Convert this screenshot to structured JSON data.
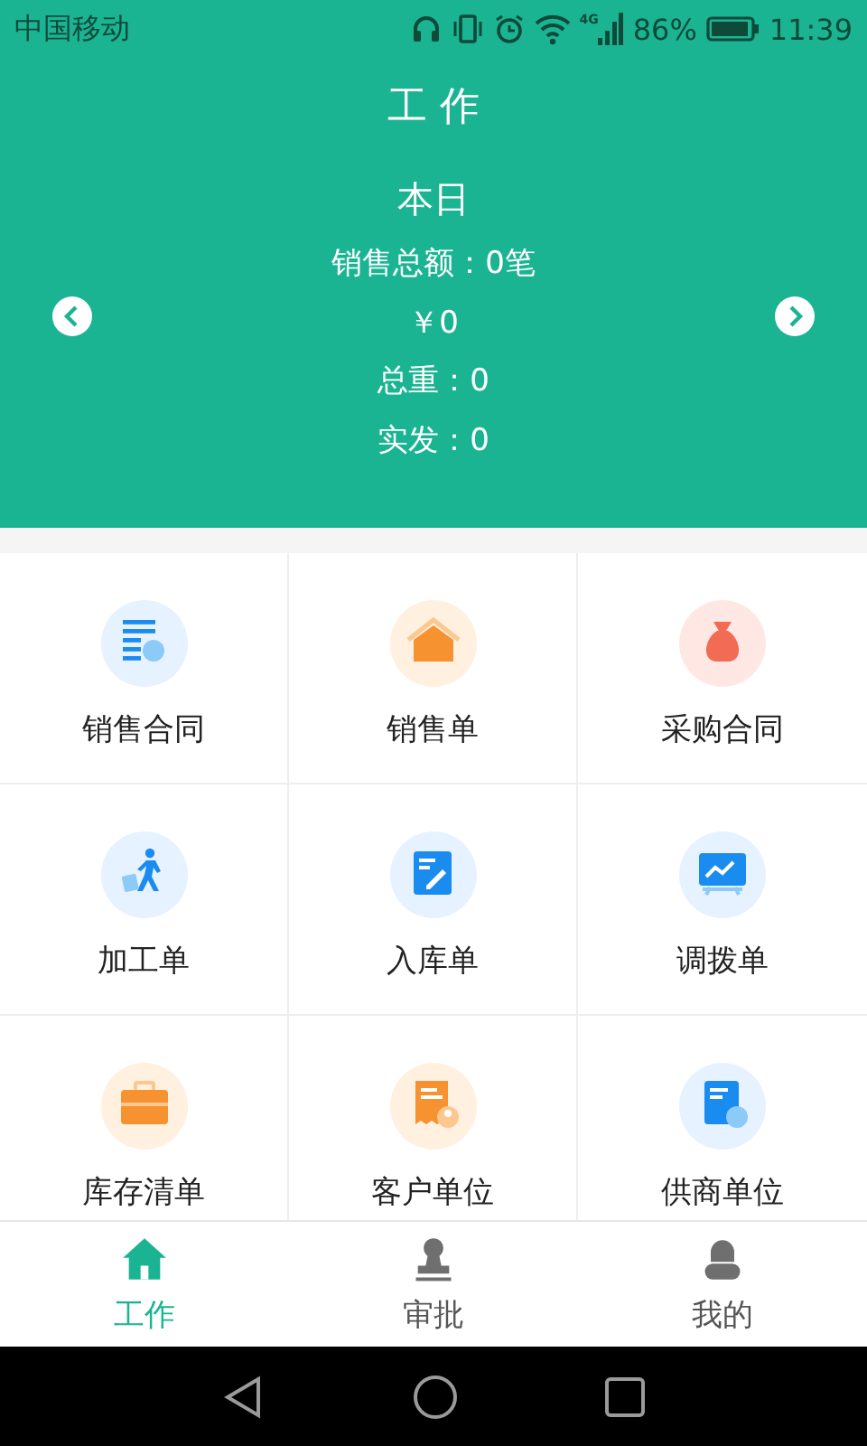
{
  "status_bar": {
    "carrier": "中国移动",
    "network": "4G",
    "battery": "86%",
    "time": "11:39"
  },
  "header": {
    "title": "工 作",
    "period": "本日",
    "lines": [
      "销售总额：0笔",
      "￥0",
      "总重：0",
      "实发：0"
    ]
  },
  "grid": [
    {
      "label": "销售合同",
      "kind": "list"
    },
    {
      "label": "销售单",
      "kind": "house"
    },
    {
      "label": "采购合同",
      "kind": "bag"
    },
    {
      "label": "加工单",
      "kind": "walker"
    },
    {
      "label": "入库单",
      "kind": "note"
    },
    {
      "label": "调拨单",
      "kind": "board"
    },
    {
      "label": "库存清单",
      "kind": "case"
    },
    {
      "label": "客户单位",
      "kind": "receipt"
    },
    {
      "label": "供商单位",
      "kind": "supplier"
    }
  ],
  "tabs": [
    {
      "label": "工作",
      "kind": "home",
      "selected": true
    },
    {
      "label": "审批",
      "kind": "stamp",
      "selected": false
    },
    {
      "label": "我的",
      "kind": "person",
      "selected": false
    }
  ]
}
